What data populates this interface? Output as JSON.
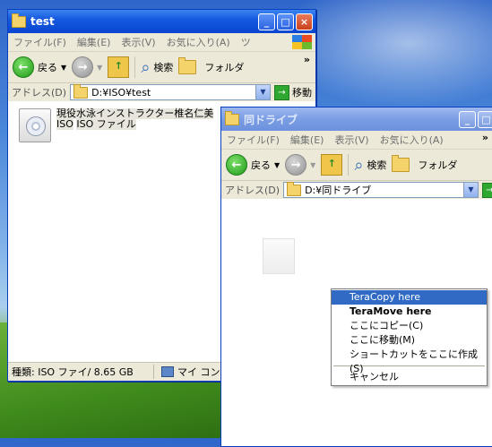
{
  "window1": {
    "title": "test",
    "menu": [
      "ファイル(F)",
      "編集(E)",
      "表示(V)",
      "お気に入り(A)",
      "ツ"
    ],
    "toolbar": {
      "back": "戻る",
      "search": "検索",
      "folders": "フォルダ"
    },
    "address_label": "アドレス(D)",
    "address_value": "D:¥ISO¥test",
    "go_label": "移動",
    "file": {
      "name": "現役水泳インストラクター椎名仁美",
      "line2": "ISO",
      "type": "ISO ファイル"
    },
    "status_left": "種類: ISO ファイ/ 8.65 GB",
    "status_right": "マイ コンピ"
  },
  "window2": {
    "title": "同ドライブ",
    "menu": [
      "ファイル(F)",
      "編集(E)",
      "表示(V)",
      "お気に入り(A)"
    ],
    "toolbar": {
      "back": "戻る",
      "search": "検索",
      "folders": "フォルダ"
    },
    "address_label": "アドレス(D)",
    "address_value": "D:¥同ドライブ"
  },
  "context_menu": {
    "items": [
      "TeraCopy here",
      "TeraMove here",
      "ここにコピー(C)",
      "ここに移動(M)",
      "ショートカットをここに作成(S)"
    ],
    "cancel": "キャンセル"
  },
  "colors": {
    "title_active": "#0a46d0",
    "title_inactive": "#7a9de4",
    "menu_highlight": "#316ac5"
  }
}
